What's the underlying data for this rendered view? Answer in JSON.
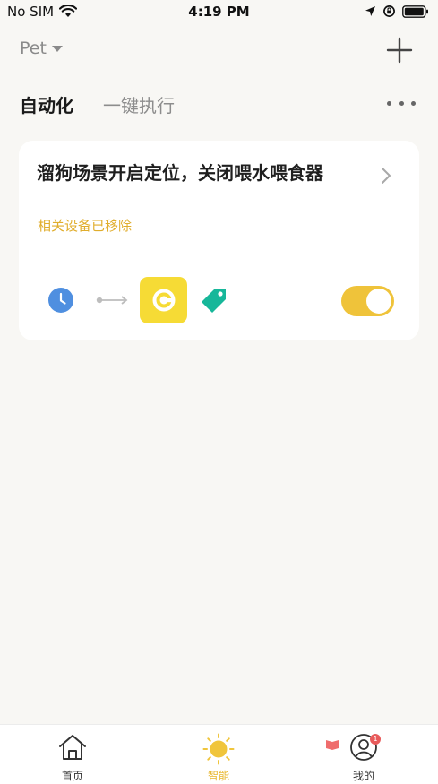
{
  "status_bar": {
    "carrier": "No SIM",
    "time": "4:19 PM"
  },
  "header": {
    "project_name": "Pet",
    "add_icon": "plus-icon"
  },
  "tabs": [
    {
      "label": "自动化",
      "active": true
    },
    {
      "label": "一键执行",
      "active": false
    }
  ],
  "more_icon": "more-dots-icon",
  "automation_card": {
    "title": "溜狗场景开启定位，关闭喂水喂食器",
    "subtitle": "相关设备已移除",
    "enabled": true,
    "condition_icon": "clock-icon",
    "action_icons": [
      "device-icon",
      "tag-icon"
    ]
  },
  "bottom_nav": [
    {
      "label": "首页",
      "icon": "home-icon",
      "active": false
    },
    {
      "label": "智能",
      "icon": "sun-icon",
      "active": true
    },
    {
      "label": "我的",
      "icon": "profile-icon",
      "active": false,
      "badge": "1"
    }
  ],
  "colors": {
    "accent": "#efc33a",
    "subtitle": "#e0ad2c",
    "device_tile": "#f6db35",
    "tag": "#17b79a",
    "clock": "#4f8fe0"
  }
}
